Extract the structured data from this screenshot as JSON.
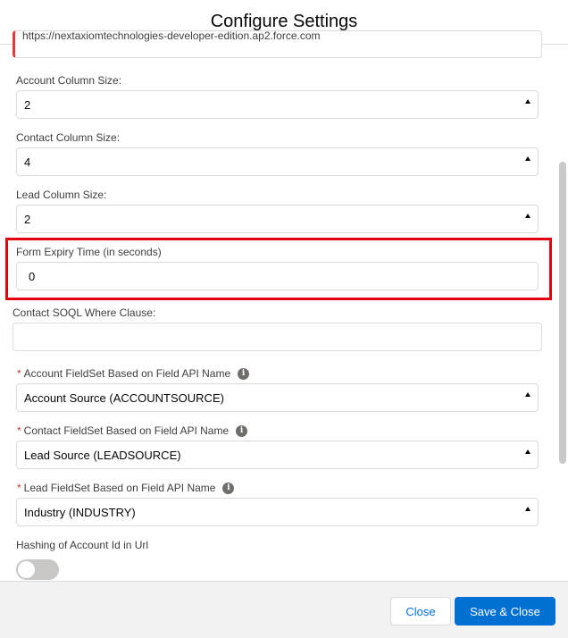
{
  "modal": {
    "title": "Configure Settings"
  },
  "fields": {
    "url_value": "https://nextaxiomtechnologies-developer-edition.ap2.force.com",
    "account_column_size": {
      "label": "Account Column Size:",
      "value": "2"
    },
    "contact_column_size": {
      "label": "Contact Column Size:",
      "value": "4"
    },
    "lead_column_size": {
      "label": "Lead Column Size:",
      "value": "2"
    },
    "form_expiry_time": {
      "label": "Form Expiry Time (in seconds)",
      "value": "0"
    },
    "contact_soql_where": {
      "label": "Contact SOQL Where Clause:",
      "value": ""
    },
    "account_fieldset": {
      "label": "Account FieldSet Based on Field API Name",
      "value": "Account Source (ACCOUNTSOURCE)",
      "required_mark": "*"
    },
    "contact_fieldset": {
      "label": "Contact FieldSet Based on Field API Name",
      "value": "Lead Source (LEADSOURCE)",
      "required_mark": "*"
    },
    "lead_fieldset": {
      "label": "Lead FieldSet Based on Field API Name",
      "value": "Industry (INDUSTRY)",
      "required_mark": "*"
    },
    "hashing_account_id": {
      "label": "Hashing of Account Id in Url",
      "enabled": false
    }
  },
  "footer": {
    "close_label": "Close",
    "save_close_label": "Save & Close"
  },
  "colors": {
    "brand": "#0070d2",
    "highlight": "#e3000f",
    "required": "#c23934"
  },
  "icons": {
    "info": "info-icon",
    "select_arrow": "chevron-up-icon"
  }
}
